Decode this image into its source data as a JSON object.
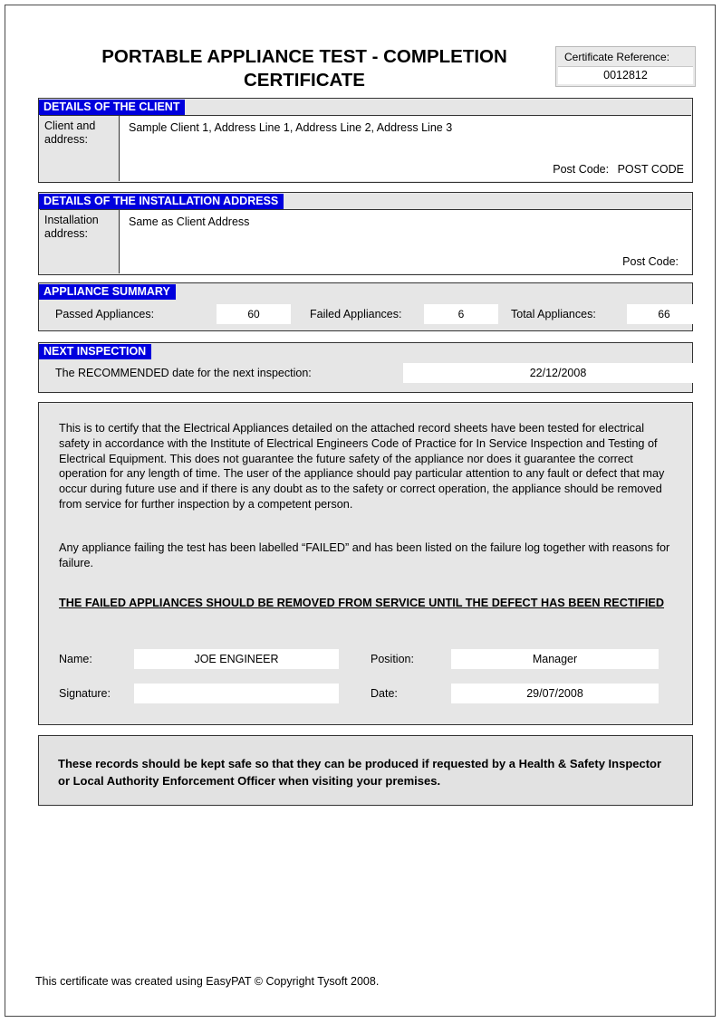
{
  "document": {
    "title": "PORTABLE APPLIANCE TEST - COMPLETION CERTIFICATE",
    "certificate_reference_label": "Certificate Reference:",
    "certificate_reference_value": "0012812"
  },
  "client_section": {
    "heading": "DETAILS OF THE CLIENT",
    "label": "Client and address:",
    "address": "Sample Client 1, Address Line 1, Address Line 2, Address Line 3",
    "post_code_label": "Post Code:",
    "post_code_value": "POST CODE"
  },
  "installation_section": {
    "heading": "DETAILS OF THE INSTALLATION ADDRESS",
    "label": "Installation address:",
    "address": "Same as Client Address",
    "post_code_label": "Post Code:",
    "post_code_value": ""
  },
  "summary_section": {
    "heading": "APPLIANCE SUMMARY",
    "passed_label": "Passed Appliances:",
    "passed_value": "60",
    "failed_label": "Failed Appliances:",
    "failed_value": "6",
    "total_label": "Total Appliances:",
    "total_value": "66"
  },
  "next_inspection_section": {
    "heading": "NEXT INSPECTION",
    "label": "The RECOMMENDED date for the next inspection:",
    "value": "22/12/2008"
  },
  "certification": {
    "paragraph_1": "This is to certify that the Electrical Appliances detailed on the attached record sheets have been tested for electrical safety in accordance with the Institute of Electrical Engineers Code of Practice for In Service Inspection and Testing of Electrical Equipment. This does not guarantee the future safety of the appliance nor does it guarantee the correct operation for any length of time. The user of the appliance should pay particular attention to any fault or defect that may occur during future use and if there is any doubt as to the safety or correct operation, the appliance should be removed from service for further inspection by a competent person.",
    "paragraph_2": "Any appliance failing the test has been labelled “FAILED” and has been listed on the failure log together with reasons for failure.",
    "warning": "THE FAILED APPLIANCES SHOULD BE REMOVED FROM SERVICE UNTIL THE DEFECT HAS BEEN RECTIFIED",
    "name_label": "Name:",
    "name_value": "JOE ENGINEER",
    "position_label": "Position:",
    "position_value": "Manager",
    "signature_label": "Signature:",
    "signature_value": "",
    "date_label": "Date:",
    "date_value": "29/07/2008"
  },
  "notice": {
    "text": "These records should be kept safe so that they can be produced if requested by a Health & Safety Inspector or Local Authority Enforcement Officer when visiting your premises."
  },
  "footer": {
    "text": "This certificate was created using EasyPAT © Copyright Tysoft 2008."
  },
  "colors": {
    "section_heading_bg": "#0000dd",
    "section_heading_text": "#ffffff",
    "panel_bg": "#e6e6e6",
    "field_bg": "#ffffff",
    "border": "#333333"
  }
}
